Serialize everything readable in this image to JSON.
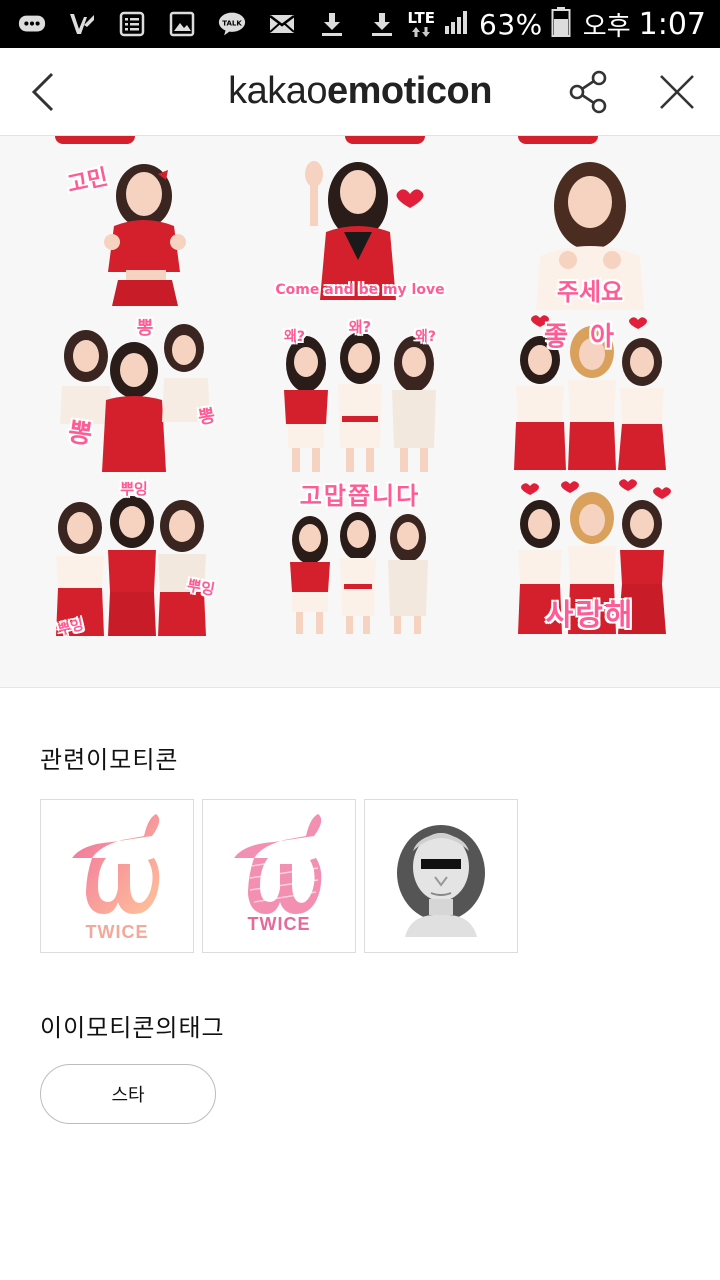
{
  "status_bar": {
    "network": "LTE",
    "battery": "63%",
    "ampm": "오후",
    "time": "1:07",
    "icons": [
      "chat-bubble-icon",
      "v-app-icon",
      "notes-icon",
      "gallery-icon",
      "kakaotalk-icon",
      "mail-icon",
      "download-icon",
      "download-icon",
      "signal-icon",
      "battery-icon"
    ],
    "talk_badge": "TALK"
  },
  "header": {
    "title_part1": "kakao",
    "title_part2": "emoticon",
    "back_icon": "chevron-left-icon",
    "share_icon": "share-icon",
    "close_icon": "close-icon"
  },
  "stickers": [
    {
      "caption": "고민"
    },
    {
      "caption": "Come and be my love"
    },
    {
      "caption": "주세요"
    },
    {
      "caption": "뽕"
    },
    {
      "caption": "왜?"
    },
    {
      "caption": "좋아"
    },
    {
      "caption": "뿌잉"
    },
    {
      "caption": "고맙쯥니다"
    },
    {
      "caption": "사랑해"
    }
  ],
  "colors": {
    "accent_red": "#d4202c",
    "caption_pink": "#ff5c95",
    "twice_pink": "#f06b9d",
    "twice_peach": "#ffc49a"
  },
  "related": {
    "title": "관련이모티콘",
    "items": [
      {
        "label": "TWICE"
      },
      {
        "label": "TWICE"
      },
      {
        "label": ""
      }
    ]
  },
  "tags": {
    "title": "이이모티콘의태그",
    "items": [
      "스타"
    ]
  }
}
